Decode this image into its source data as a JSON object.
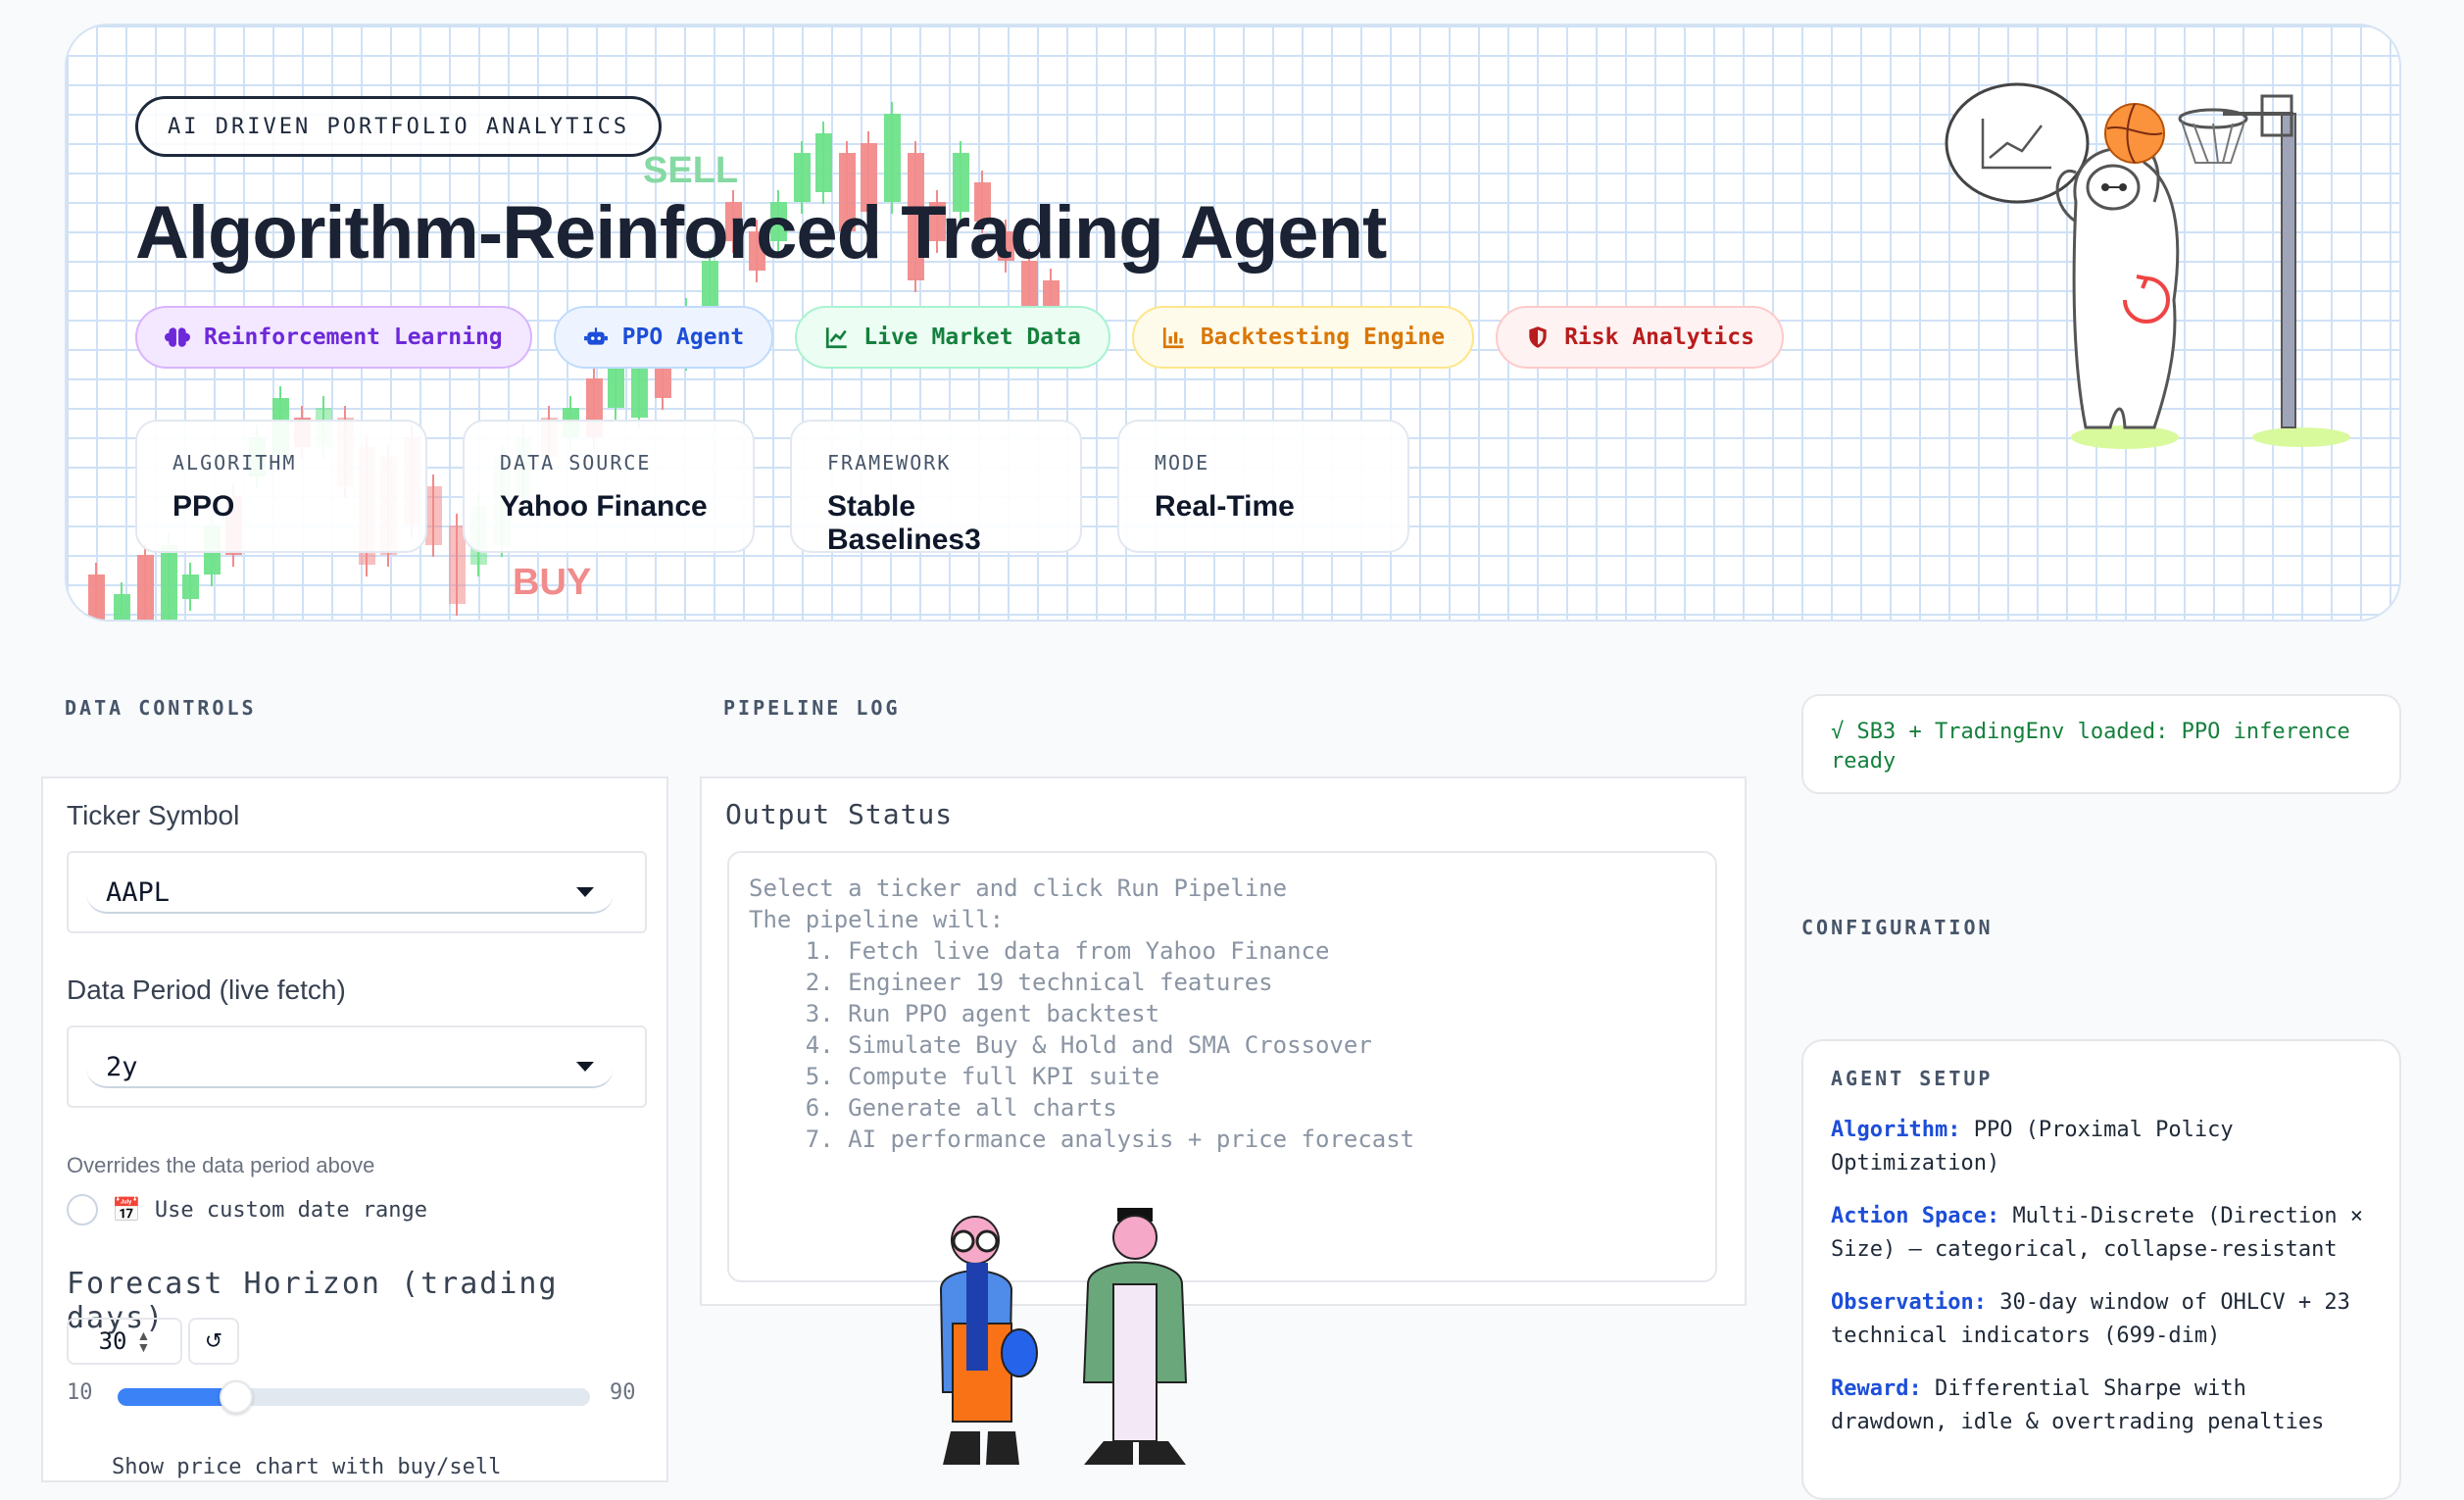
{
  "hero": {
    "eyebrow": "AI DRIVEN PORTFOLIO ANALYTICS",
    "title": "Algorithm-Reinforced Trading Agent",
    "chart_sell": "SELL",
    "chart_buy": "BUY",
    "tags": [
      {
        "label": "Reinforcement Learning",
        "icon": "brain-icon",
        "color": "#6d28d9",
        "bg": "#f3e8ff",
        "border": "#d8b4fe"
      },
      {
        "label": "PPO Agent",
        "icon": "robot-icon",
        "color": "#1d4ed8",
        "bg": "#eef4ff",
        "border": "#bfdbfe"
      },
      {
        "label": "Live Market Data",
        "icon": "line-chart-icon",
        "color": "#15803d",
        "bg": "#ecfdf3",
        "border": "#a7f3d0"
      },
      {
        "label": "Backtesting Engine",
        "icon": "bar-chart-icon",
        "color": "#d97706",
        "bg": "#fffbeb",
        "border": "#fde68a"
      },
      {
        "label": "Risk Analytics",
        "icon": "shield-icon",
        "color": "#b91c1c",
        "bg": "#fef2f2",
        "border": "#fecaca"
      }
    ],
    "stats": [
      {
        "key": "ALGORITHM",
        "value": "PPO"
      },
      {
        "key": "DATA SOURCE",
        "value": "Yahoo Finance"
      },
      {
        "key": "FRAMEWORK",
        "value": "Stable Baselines3"
      },
      {
        "key": "MODE",
        "value": "Real-Time"
      }
    ]
  },
  "controls": {
    "section": "DATA CONTROLS",
    "ticker_label": "Ticker Symbol",
    "ticker_value": "AAPL",
    "period_label": "Data Period (live fetch)",
    "period_value": "2y",
    "override_note": "Overrides the data period above",
    "custom_range_icon": "📅",
    "custom_range_label": "Use custom date range",
    "forecast_label": "Forecast Horizon (trading days)",
    "forecast_value": "30",
    "reset_glyph": "↺",
    "slider_min": "10",
    "slider_max": "90",
    "slider_value": 30,
    "cut_text": "Show price chart with buy/sell"
  },
  "pipeline": {
    "section": "PIPELINE LOG",
    "output_label": "Output Status",
    "log": "Select a ticker and click Run Pipeline\nThe pipeline will:\n    1. Fetch live data from Yahoo Finance\n    2. Engineer 19 technical features\n    3. Run PPO agent backtest\n    4. Simulate Buy & Hold and SMA Crossover\n    5. Compute full KPI suite\n    6. Generate all charts\n    7. AI performance analysis + price forecast"
  },
  "status": {
    "text": "√ SB3 + TradingEnv loaded: PPO inference ready"
  },
  "config": {
    "section": "CONFIGURATION",
    "card_title": "AGENT SETUP",
    "items": [
      {
        "k": "Algorithm:",
        "v": "PPO (Proximal Policy Optimization)"
      },
      {
        "k": "Action Space:",
        "v": "Multi-Discrete (Direction × Size) — categorical, collapse-resistant"
      },
      {
        "k": "Observation:",
        "v": "30-day window of OHLCV + 23 technical indicators (699-dim)"
      },
      {
        "k": "Reward:",
        "v": "Differential Sharpe with drawdown, idle & overtrading penalties"
      }
    ]
  }
}
